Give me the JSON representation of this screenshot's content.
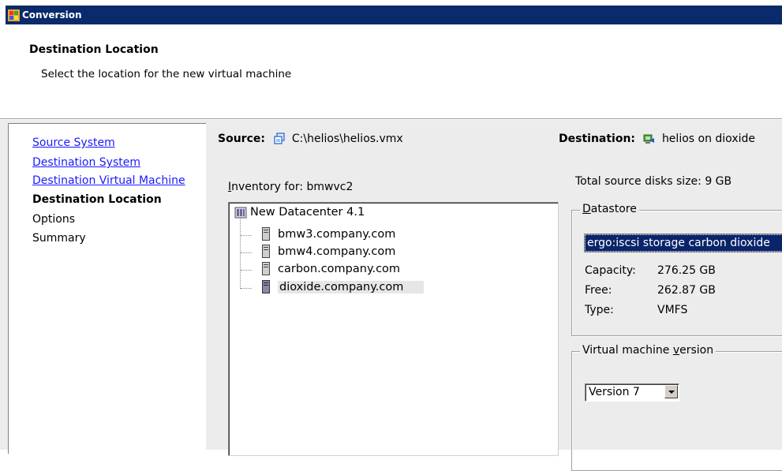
{
  "window": {
    "title": "Conversion"
  },
  "header": {
    "title": "Destination Location",
    "subtitle": "Select the location for the new virtual machine"
  },
  "nav": {
    "items": [
      {
        "label": "Source System",
        "state": "link"
      },
      {
        "label": "Destination System",
        "state": "link"
      },
      {
        "label": "Destination Virtual Machine",
        "state": "link"
      },
      {
        "label": "Destination Location",
        "state": "current"
      },
      {
        "label": "Options",
        "state": "pending"
      },
      {
        "label": "Summary",
        "state": "pending"
      }
    ]
  },
  "source": {
    "label": "Source:",
    "value": "C:\\helios\\helios.vmx"
  },
  "destination": {
    "label": "Destination:",
    "value": "helios on dioxide"
  },
  "inventory": {
    "label_underlined": "I",
    "label_rest": "nventory for:",
    "host": "bmwvc2",
    "tree": {
      "root": "New Datacenter 4.1",
      "children": [
        "bmw3.company.com",
        "bmw4.company.com",
        "carbon.company.com",
        "dioxide.company.com"
      ],
      "selected": "dioxide.company.com"
    }
  },
  "disk": {
    "label": "Total source disks size:",
    "value": "9 GB"
  },
  "datastore": {
    "legend_underlined": "D",
    "legend_rest": "atastore",
    "selected": "ergo:iscsi storage carbon dioxide",
    "capacity_label": "Capacity:",
    "capacity": "276.25 GB",
    "free_label": "Free:",
    "free": "262.87 GB",
    "type_label": "Type:",
    "type": "VMFS"
  },
  "vm_version": {
    "legend_pre": "Virtual machine ",
    "legend_underlined": "v",
    "legend_post": "ersion",
    "selected": "Version 7"
  },
  "colors": {
    "title_bar": "#0a2a6b",
    "link": "#1a1aff",
    "selection": "#0a246a",
    "panel_bg": "#ececec"
  }
}
